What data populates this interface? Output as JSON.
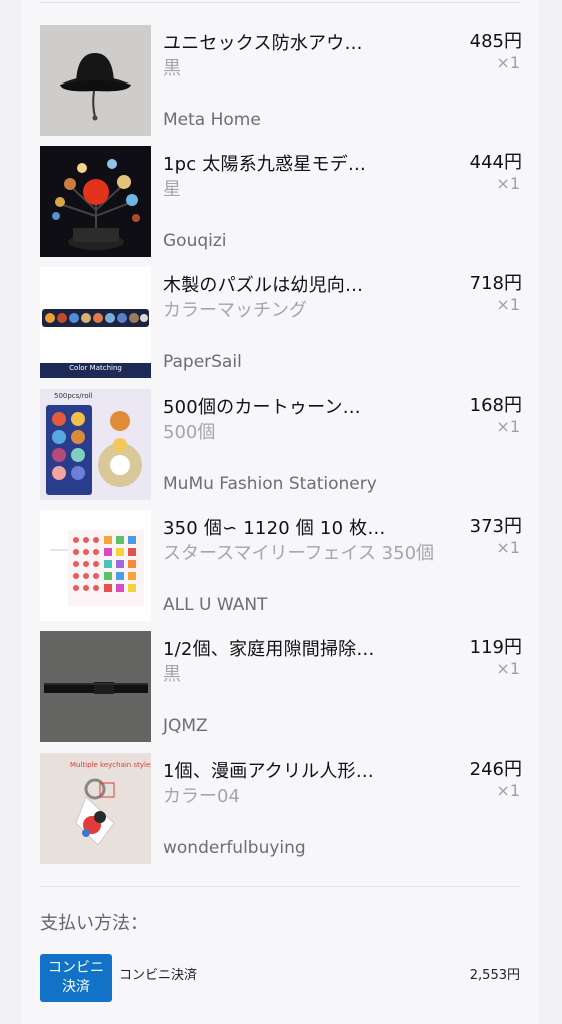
{
  "items": [
    {
      "title": "ユニセックス防水アウ…",
      "variant": "黒",
      "price": "485円",
      "qty": "×1",
      "store": "Meta Home",
      "image": "black-bucket-hat"
    },
    {
      "title": "1pc 太陽系九惑星モデ…",
      "variant": "星",
      "price": "444円",
      "qty": "×1",
      "store": "Gouqizi",
      "image": "solar-system-model"
    },
    {
      "title": "木製のパズルは幼児向…",
      "variant": "カラーマッチング",
      "price": "718円",
      "qty": "×1",
      "store": "PaperSail",
      "image": "planet-puzzle",
      "image_text": "Color Matching"
    },
    {
      "title": "500個のカートゥーン…",
      "variant": "500個",
      "price": "168円",
      "qty": "×1",
      "store": "MuMu Fashion Stationery",
      "image": "planet-sticker-roll",
      "image_text": "500pcs/roll"
    },
    {
      "title": "350 個∽ 1120 個 10 枚…",
      "variant": "スタースマイリーフェイス 350個",
      "price": "373円",
      "qty": "×1",
      "store": "ALL U WANT",
      "image": "star-sticker-sheets"
    },
    {
      "title": "1/2個、家庭用隙間掃除…",
      "variant": "黒",
      "price": "119円",
      "qty": "×1",
      "store": "JQMZ",
      "image": "gap-cleaning-strip"
    },
    {
      "title": "1個、漫画アクリル人形…",
      "variant": "カラー04",
      "price": "246円",
      "qty": "×1",
      "store": "wonderfulbuying",
      "image": "acrylic-keychain",
      "image_text": "Multiple keychain styles random"
    }
  ],
  "payment": {
    "label": "支払い方法：",
    "badge_line1": "コンビニ",
    "badge_line2": "決済",
    "name": "コンビニ決済",
    "amount": "2,553円",
    "badge_color": "#1272c8"
  }
}
